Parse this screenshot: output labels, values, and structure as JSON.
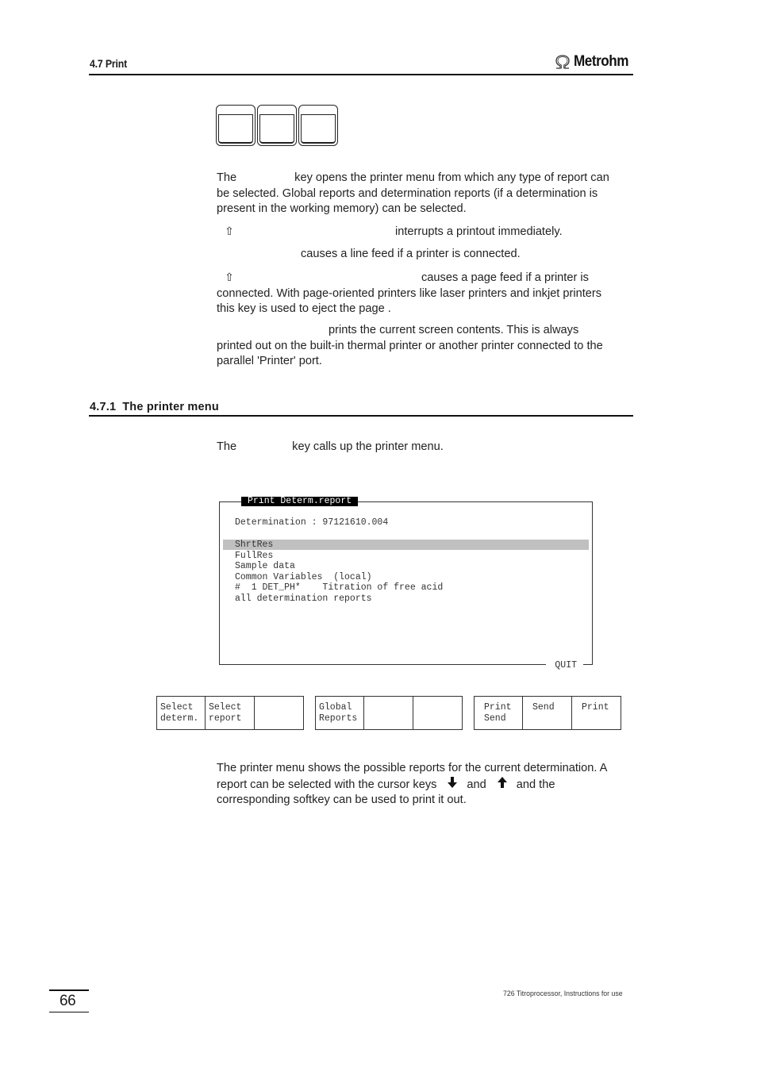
{
  "header": {
    "section": "4.7 Print",
    "brand": "Metrohm",
    "brand_icon": "omega-icon"
  },
  "keys": {
    "count": 3,
    "labels": [
      "",
      "",
      ""
    ]
  },
  "intro": {
    "p1_start": "The",
    "p1_rest_line1": "key opens the printer menu from which any type of report can",
    "p1_line2": "be selected. Global reports and determination reports (if a determination is",
    "p1_line3": "present in the working memory) can be selected.",
    "shift_symbol": "⇧",
    "p2": "interrupts a printout immediately.",
    "p3": "causes a line feed  if a printer is connected.",
    "p4_line1": "causes a page feed  if a printer is",
    "p4_line2": "connected. With page-oriented printers like laser printers and inkjet printers",
    "p4_line3": "this key is used to eject the page .",
    "p5_line1": "prints the current screen contents. This is always",
    "p5_line2": "printed out on the built-in thermal printer or another printer connected to the",
    "p5_line3": "parallel 'Printer' port."
  },
  "section": {
    "number": "4.7.1",
    "title": "The printer menu",
    "intro_start": "The",
    "intro_rest": "key calls up the printer menu."
  },
  "screen": {
    "title": "Print Determ.report",
    "determination_label": "Determination : 97121610.004",
    "items": [
      "ShrtRes",
      "FullRes",
      "Sample data",
      "Common Variables  (local)",
      "#  1 DET_PH*    Titration of free acid",
      "all determination reports"
    ],
    "selected_index": 0,
    "quit_label": "QUIT"
  },
  "softkeys": {
    "group1": [
      "Select\ndeterm.",
      "Select\nreport",
      ""
    ],
    "group2": [
      "Global\nReports",
      "",
      ""
    ],
    "group3": [
      "Print\nSend",
      "Send",
      "Print"
    ]
  },
  "explanation": {
    "line1": "The printer menu shows the possible reports for the current determination. A",
    "line2_start": "report can be selected with the cursor keys",
    "down_arrow": "🡇",
    "and1": "and",
    "up_arrow": "🡅",
    "line2_end": "and the",
    "line3": "corresponding softkey can be used to print it out."
  },
  "footer": {
    "page_number": "66",
    "doc_title": "726 Titroprocessor, Instructions for use"
  }
}
